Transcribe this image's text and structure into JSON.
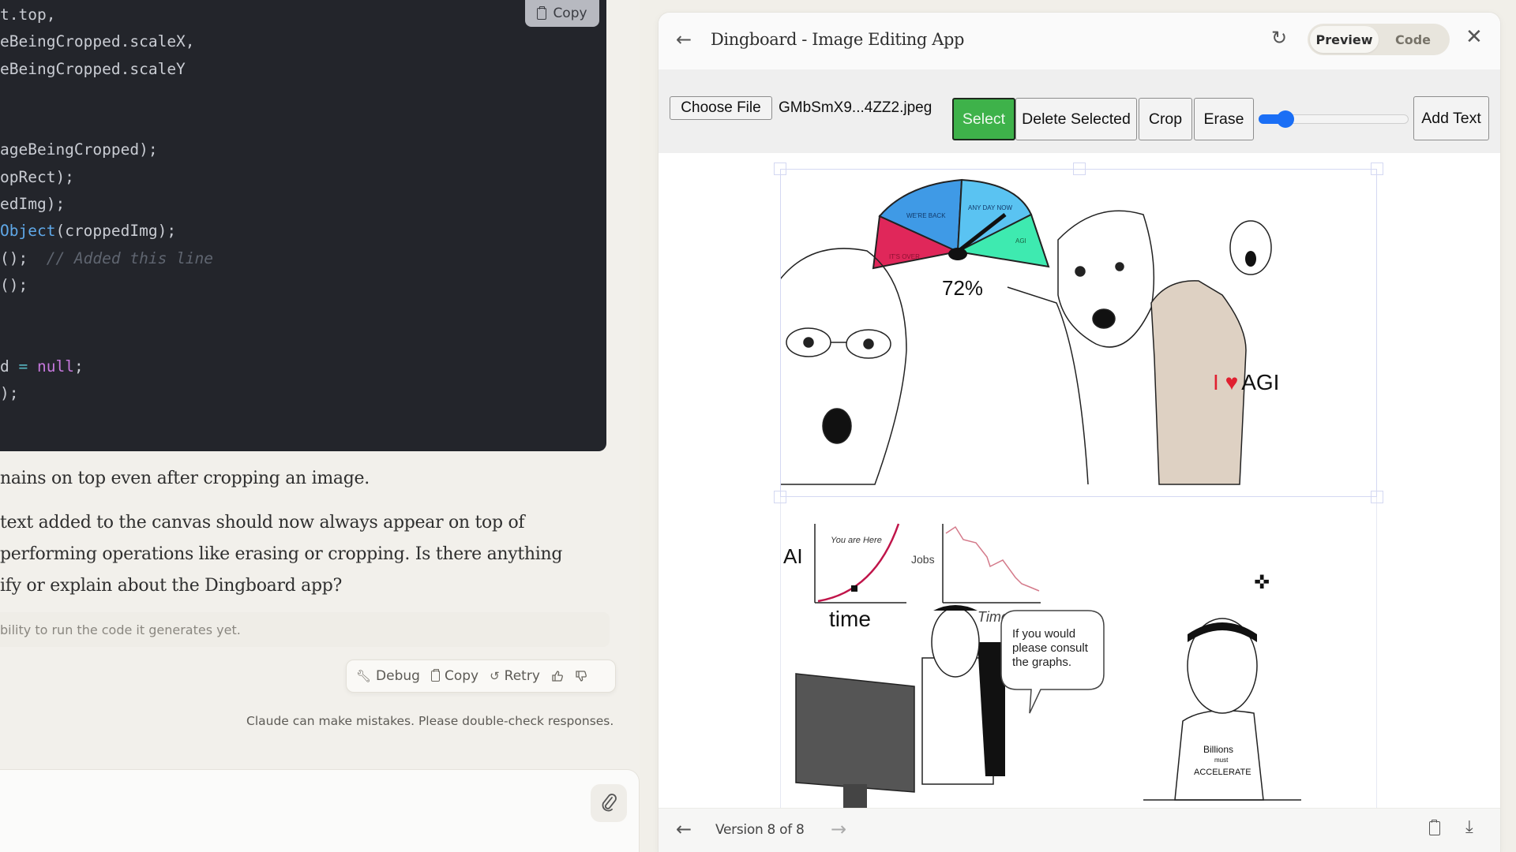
{
  "chat": {
    "code_block": {
      "copy_label": "Copy",
      "lines": [
        [
          {
            "t": "t.top,",
            "c": ""
          }
        ],
        [
          {
            "t": "eBeingCropped.scaleX,",
            "c": ""
          }
        ],
        [
          {
            "t": "eBeingCropped.scaleY",
            "c": ""
          }
        ],
        [
          {
            "t": "",
            "c": ""
          }
        ],
        [
          {
            "t": "",
            "c": ""
          }
        ],
        [
          {
            "t": "ageBeingCropped);",
            "c": ""
          }
        ],
        [
          {
            "t": "opRect);",
            "c": ""
          }
        ],
        [
          {
            "t": "edImg);",
            "c": ""
          }
        ],
        [
          {
            "t": "Object",
            "c": "fn"
          },
          {
            "t": "(croppedImg);",
            "c": ""
          }
        ],
        [
          {
            "t": "();  ",
            "c": ""
          },
          {
            "t": "// Added this line",
            "c": "cm"
          }
        ],
        [
          {
            "t": "();",
            "c": ""
          }
        ],
        [
          {
            "t": "",
            "c": ""
          }
        ],
        [
          {
            "t": "",
            "c": ""
          }
        ],
        [
          {
            "t": "d ",
            "c": ""
          },
          {
            "t": "=",
            "c": "op"
          },
          {
            "t": " ",
            "c": ""
          },
          {
            "t": "null",
            "c": "kw"
          },
          {
            "t": ";",
            "c": ""
          }
        ],
        [
          {
            "t": ");",
            "c": ""
          }
        ]
      ]
    },
    "message_paragraphs": [
      "nains on top even after cropping an image.",
      "text added to the canvas should now always appear on top of",
      "performing operations like erasing or cropping. Is there anything",
      "ify or explain about the Dingboard app?"
    ],
    "notice": "bility to run the code it generates yet.",
    "actions": {
      "debug": "Debug",
      "copy": "Copy",
      "retry": "Retry"
    },
    "disclaimer": "Claude can make mistakes. Please double-check responses.",
    "composer": {
      "value": "",
      "placeholder": ""
    }
  },
  "artifact": {
    "title": "Dingboard - Image Editing App",
    "view_toggle": {
      "options": [
        "Preview",
        "Code"
      ],
      "selected": "Preview"
    },
    "toolbar": {
      "choose_file": "Choose File",
      "file_name": "GMbSmX9...4ZZ2.jpeg",
      "select": "Select",
      "delete_selected": "Delete Selected",
      "crop": "Crop",
      "erase": "Erase",
      "add_text": "Add Text",
      "brush_size_fraction": 0.18,
      "accent_color": "#1a6ef5",
      "select_active_color": "#3eb24a"
    },
    "canvas": {
      "meme": {
        "gauge_segments": [
          "IT'S OVER",
          "WE'RE BACK",
          "ANY DAY NOW",
          "AGI"
        ],
        "gauge_value": "72%",
        "shirt_text": "I ♥ AGI",
        "graph1": {
          "ylabel": "AI",
          "xlabel": "time",
          "annotation": "You are Here"
        },
        "graph2": {
          "ylabel": "Jobs",
          "xlabel": "Time"
        },
        "speech_bubble": [
          "If you would",
          "please consult",
          "the graphs."
        ],
        "shirt2_text": [
          "Billions",
          "must",
          "ACCELERATE"
        ]
      }
    },
    "footer": {
      "version_label": "Version 8 of 8",
      "current_version": 8,
      "total_versions": 8
    }
  }
}
